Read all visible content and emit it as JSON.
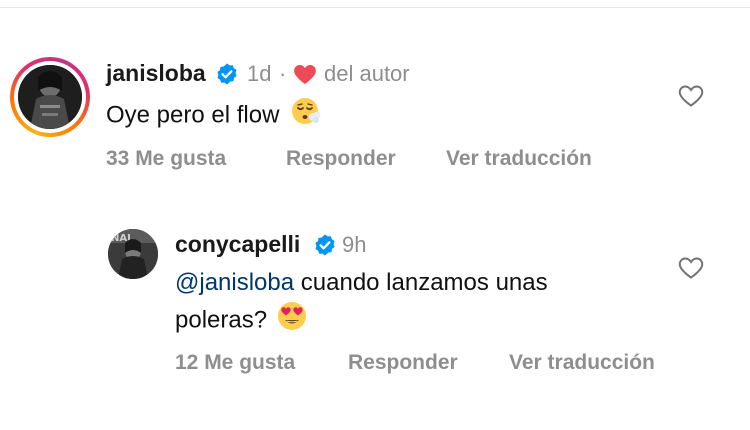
{
  "comments": [
    {
      "username": "janisloba",
      "time": "1d",
      "separator": "·",
      "author_badge": "del autor",
      "text": "Oye pero el flow",
      "emoji": "exhaling-face",
      "likes": "33 Me gusta",
      "reply": "Responder",
      "translate": "Ver traducción"
    },
    {
      "username": "conycapelli",
      "time": "9h",
      "mention": "@janisloba",
      "text_line1": " cuando lanzamos unas",
      "text_line2": "poleras?",
      "emoji": "heart-eyes-face",
      "likes": "12 Me gusta",
      "reply": "Responder",
      "translate": "Ver traducción"
    }
  ],
  "colors": {
    "verified": "#0095f6",
    "heart": "#ed4956",
    "secondary_text": "#8e8e8e",
    "mention": "#00376b"
  }
}
